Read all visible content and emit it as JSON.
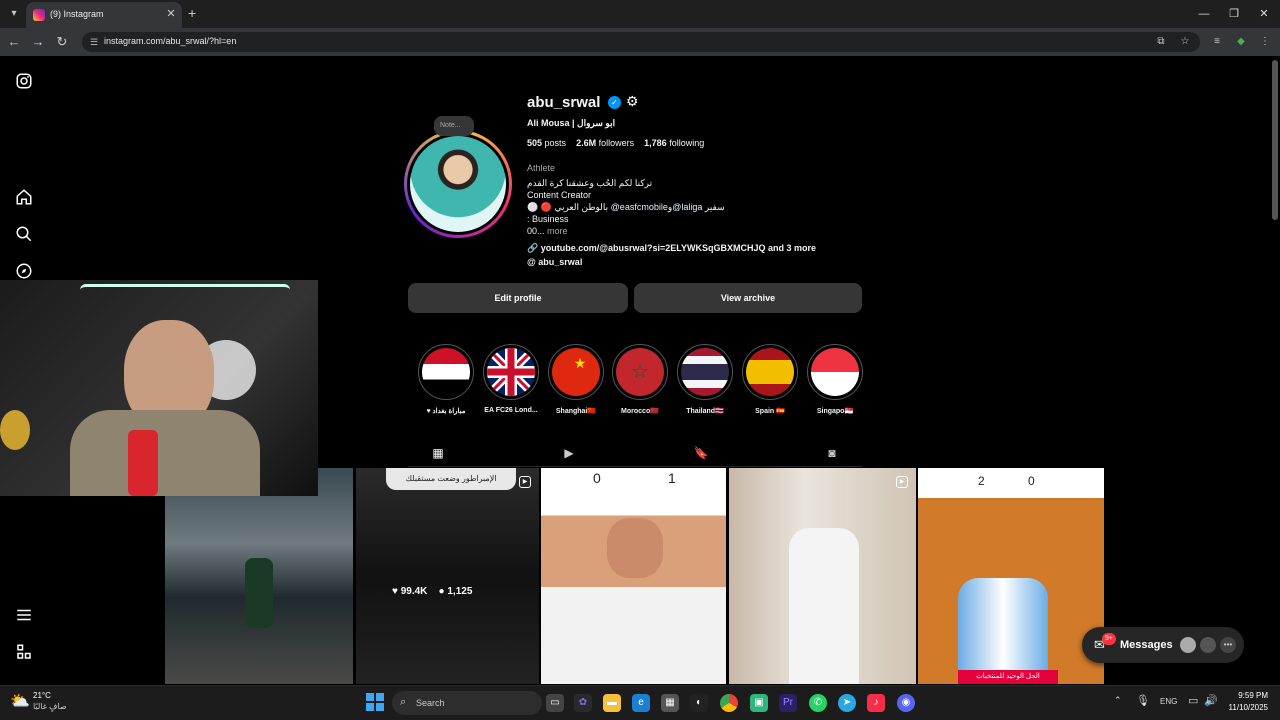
{
  "browser": {
    "tab_title": "(9) Instagram",
    "url": "instagram.com/abu_srwal/?hl=en",
    "icons": [
      "chevron-down-icon",
      "instagram-favicon",
      "close-icon",
      "plus-icon",
      "minimize-icon",
      "maximize-icon",
      "close-window-icon",
      "back-icon",
      "forward-icon",
      "reload-icon",
      "site-info-icon",
      "install-icon",
      "star-icon",
      "tab-search-icon",
      "extension-icon",
      "menu-icon"
    ]
  },
  "sidebar": {
    "icons": [
      "instagram-logo-icon",
      "home-icon",
      "search-icon",
      "explore-icon",
      "menu-icon",
      "meta-apps-icon"
    ]
  },
  "profile": {
    "note_label": "Note...",
    "username": "abu_srwal",
    "full_name": "Ali Mousa | ابو سروال",
    "posts_count": "505",
    "posts_label": "posts",
    "followers_count": "2.6M",
    "followers_label": "followers",
    "following_count": "1,786",
    "following_label": "following",
    "category": "Athlete",
    "bio_line1": "تركنا لكم الحُب وعشقنا كرة القدم",
    "bio_line2": "Content Creator",
    "bio_line3_pre": "سفير ",
    "bio_line3_link1": "@laliga",
    "bio_line3_mid": "و",
    "bio_line3_link2": "@easfcmobile",
    "bio_line3_post": " بالوطن العربي",
    "bio_line4": ": Business",
    "bio_line5": "00...",
    "more_label": "more",
    "link_text": "youtube.com/@abusrwal?si=2ELYWKSqGBXMCHJQ and 3 more",
    "threads_handle": "abu_srwal",
    "edit_profile": "Edit profile",
    "view_archive": "View archive"
  },
  "highlights": [
    {
      "label": "♥ مباراة بغداد",
      "flag": "iraq"
    },
    {
      "label": "EA FC26 Lond...",
      "flag": "uk"
    },
    {
      "label": "Shanghai🇨🇳",
      "flag": "china"
    },
    {
      "label": "Morocco🇲🇦",
      "flag": "morocco"
    },
    {
      "label": "Thailand🇹🇭",
      "flag": "thailand"
    },
    {
      "label": "Spain 🇪🇸",
      "flag": "spain"
    },
    {
      "label": "Singapo🇸🇬",
      "flag": "singapore"
    }
  ],
  "profile_tabs": [
    "grid-icon",
    "reels-icon",
    "saved-icon",
    "tagged-icon"
  ],
  "posts": [
    {
      "kind": "football-pitch"
    },
    {
      "kind": "night-match",
      "caption": "الإمبراطور وضعت مستقبلك",
      "likes": "99.4K",
      "comments": "1,125"
    },
    {
      "kind": "realmadrid",
      "score_left": "0",
      "score_right": "1"
    },
    {
      "kind": "tanktop"
    },
    {
      "kind": "argentina",
      "score_left": "2",
      "score_right": "0",
      "caption": "الحل الوحيد للمنتخبات"
    }
  ],
  "messages": {
    "label": "Messages",
    "badge": "9+"
  },
  "taskbar": {
    "weather_temp": "21°C",
    "weather_desc": "صافٍ غالبًا",
    "search_placeholder": "Search",
    "lang": "ENG",
    "time": "9:59 PM",
    "date": "11/10/2025"
  }
}
